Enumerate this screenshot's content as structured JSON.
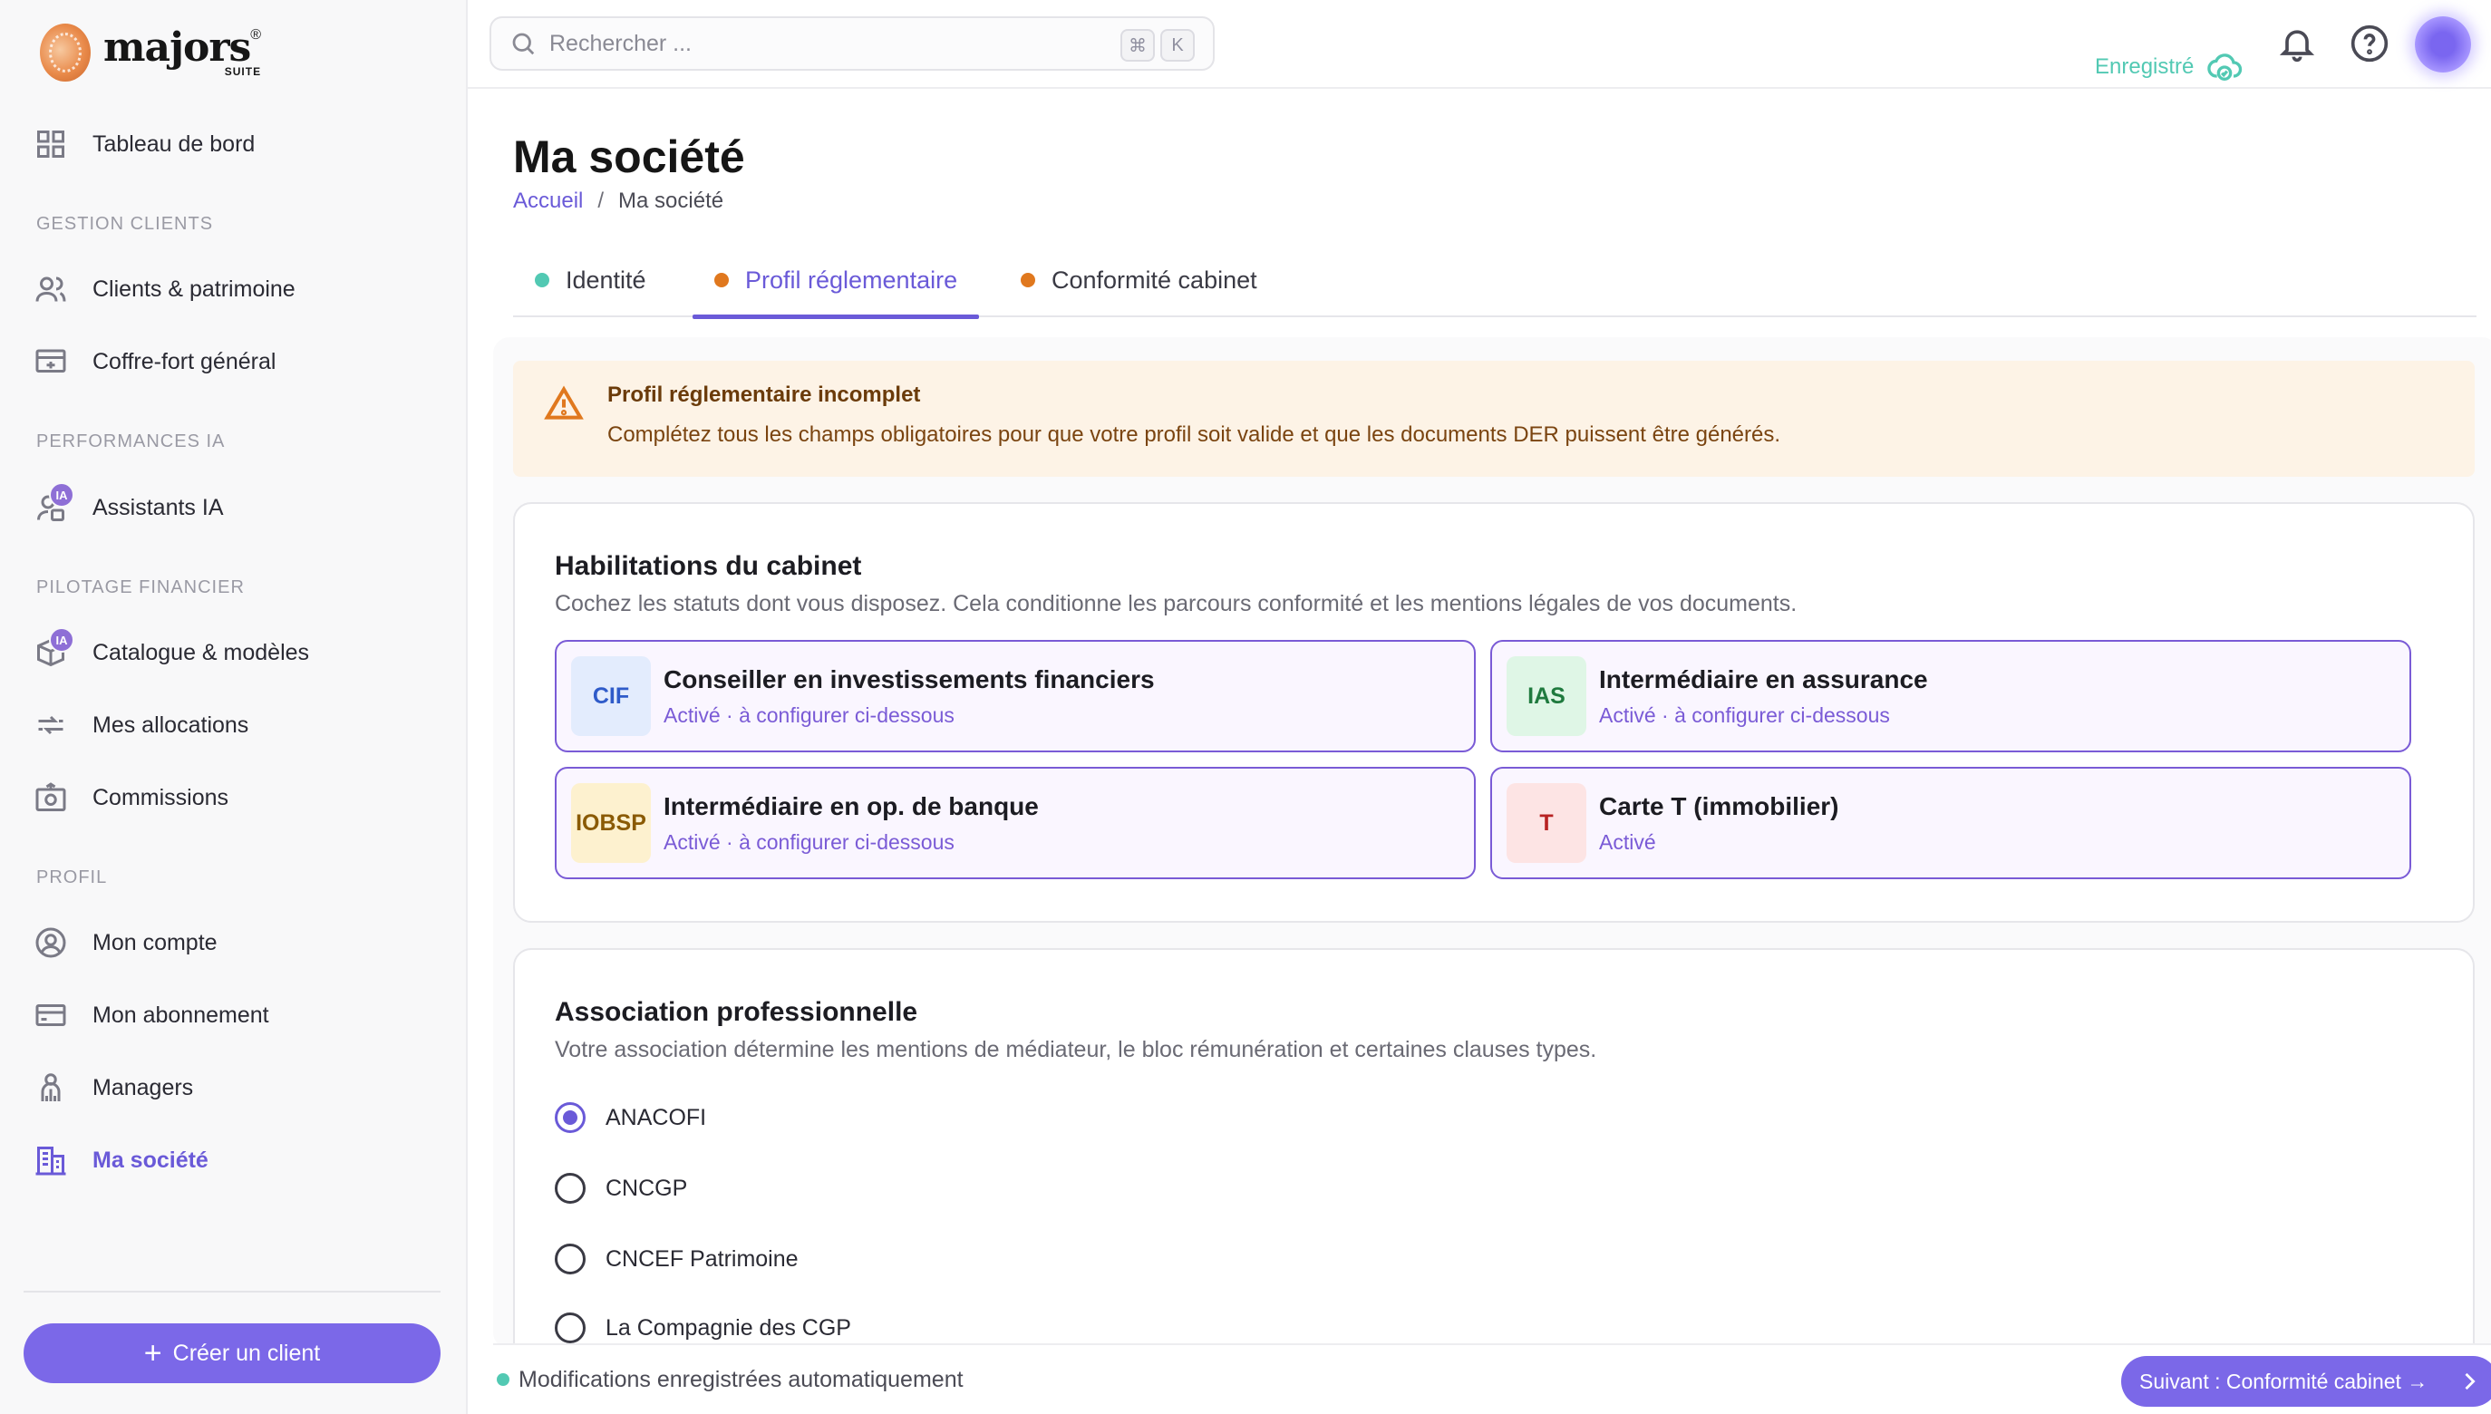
{
  "logo": {
    "word": "majors",
    "suite": "SUITE",
    "reg": "®"
  },
  "sidebar": {
    "dashboard": "Tableau de bord",
    "sections": [
      {
        "title": "GESTION CLIENTS",
        "items": [
          "Clients & patrimoine",
          "Coffre-fort général"
        ]
      },
      {
        "title": "PERFORMANCES IA",
        "items": [
          "Assistants IA"
        ]
      },
      {
        "title": "PILOTAGE FINANCIER",
        "items": [
          "Catalogue & modèles",
          "Mes allocations",
          "Commissions"
        ]
      },
      {
        "title": "PROFIL",
        "items": [
          "Mon compte",
          "Mon abonnement",
          "Managers",
          "Ma société"
        ]
      }
    ],
    "ia_badge": "IA",
    "create_button": "Créer un client",
    "create_plus": "+"
  },
  "topbar": {
    "search_placeholder": "Rechercher ...",
    "kbd_cmd": "⌘",
    "kbd_k": "K",
    "saved_label": "Enregistré"
  },
  "page": {
    "title": "Ma société",
    "breadcrumb": {
      "home": "Accueil",
      "sep": "/",
      "current": "Ma société"
    }
  },
  "tabs": [
    {
      "label": "Identité",
      "dot_color": "#52c9b3"
    },
    {
      "label": "Profil réglementaire",
      "dot_color": "#e0781e"
    },
    {
      "label": "Conformité cabinet",
      "dot_color": "#e0781e"
    }
  ],
  "alert": {
    "title": "Profil réglementaire incomplet",
    "body": "Complétez tous les champs obligatoires pour que votre profil soit valide et que les documents DER puissent être générés."
  },
  "habilitations": {
    "title": "Habilitations du cabinet",
    "description": "Cochez les statuts dont vous disposez. Cela conditionne les parcours conformité et les mentions légales de vos documents.",
    "items": [
      {
        "code": "CIF",
        "title": "Conseiller en investissements financiers",
        "status": "Activé · à configurer ci-dessous",
        "badge_bg": "#e3ecfd",
        "badge_fg": "#2f5bc9"
      },
      {
        "code": "IAS",
        "title": "Intermédiaire en assurance",
        "status": "Activé · à configurer ci-dessous",
        "badge_bg": "#dff6e6",
        "badge_fg": "#1f7a3e"
      },
      {
        "code": "IOBSP",
        "title": "Intermédiaire en op. de banque",
        "status": "Activé · à configurer ci-dessous",
        "badge_bg": "#fdf1cf",
        "badge_fg": "#8a5a05"
      },
      {
        "code": "T",
        "title": "Carte T (immobilier)",
        "status": "Activé",
        "badge_bg": "#fde4e4",
        "badge_fg": "#b82222"
      }
    ]
  },
  "association": {
    "title": "Association professionnelle",
    "description": "Votre association détermine les mentions de médiateur, le bloc rémunération et certaines clauses types.",
    "options": [
      "ANACOFI",
      "CNCGP",
      "CNCEF Patrimoine",
      "La Compagnie des CGP"
    ],
    "selected": "ANACOFI"
  },
  "footer": {
    "autosave": "Modifications enregistrées automatiquement",
    "next_button": "Suivant : Conformité cabinet →"
  },
  "colors": {
    "accent": "#6a5ad8",
    "button": "#7b68e8",
    "success": "#52c9b3",
    "warning": "#e0781e"
  }
}
